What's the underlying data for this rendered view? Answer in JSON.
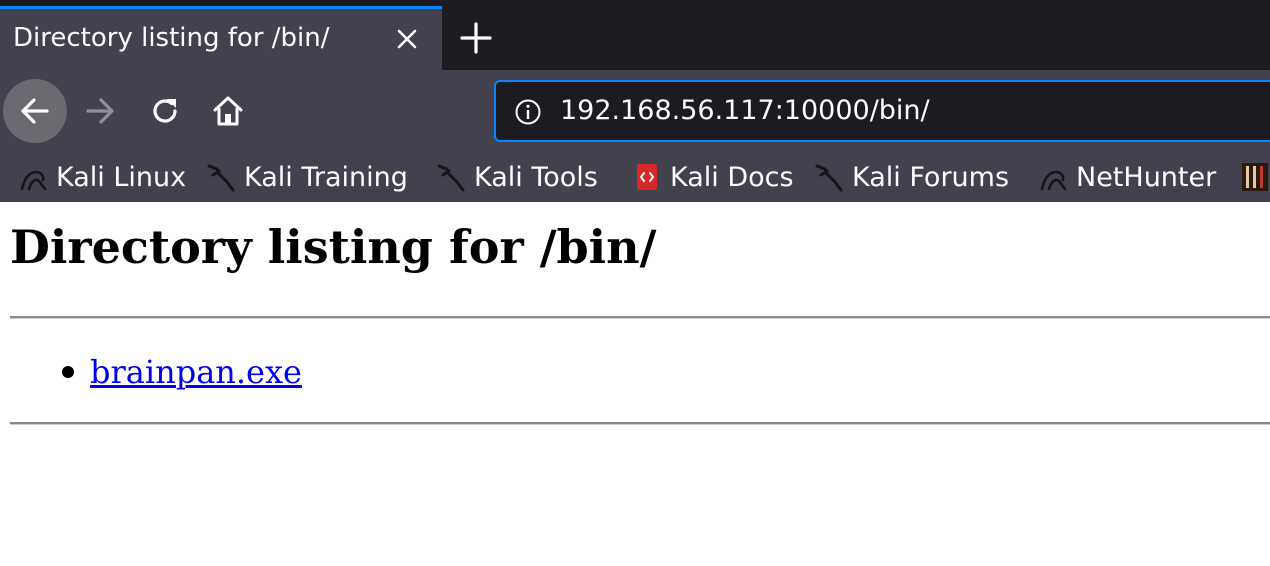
{
  "tab": {
    "title": "Directory listing for /bin/",
    "close_icon": "close-icon",
    "new_tab_icon": "plus-icon"
  },
  "navigation": {
    "back_icon": "arrow-left-icon",
    "forward_icon": "arrow-right-icon",
    "reload_icon": "reload-icon",
    "home_icon": "home-icon"
  },
  "urlbar": {
    "info_icon": "info-icon",
    "url": "192.168.56.117:10000/bin/"
  },
  "bookmarks": [
    {
      "label": "Kali Linux",
      "icon": "kali-dragon-icon"
    },
    {
      "label": "Kali Training",
      "icon": "kali-sword-icon"
    },
    {
      "label": "Kali Tools",
      "icon": "kali-sword-icon"
    },
    {
      "label": "Kali Docs",
      "icon": "kali-docs-icon"
    },
    {
      "label": "Kali Forums",
      "icon": "kali-sword-icon"
    },
    {
      "label": "NetHunter",
      "icon": "kali-dragon-icon"
    }
  ],
  "page": {
    "heading": "Directory listing for /bin/",
    "files": [
      {
        "name": "brainpan.exe"
      }
    ]
  },
  "colors": {
    "tab_accent": "#0a84ff",
    "link": "#0000ee",
    "toolbar_bg": "#42414d",
    "tabstrip_bg": "#1c1b22"
  }
}
